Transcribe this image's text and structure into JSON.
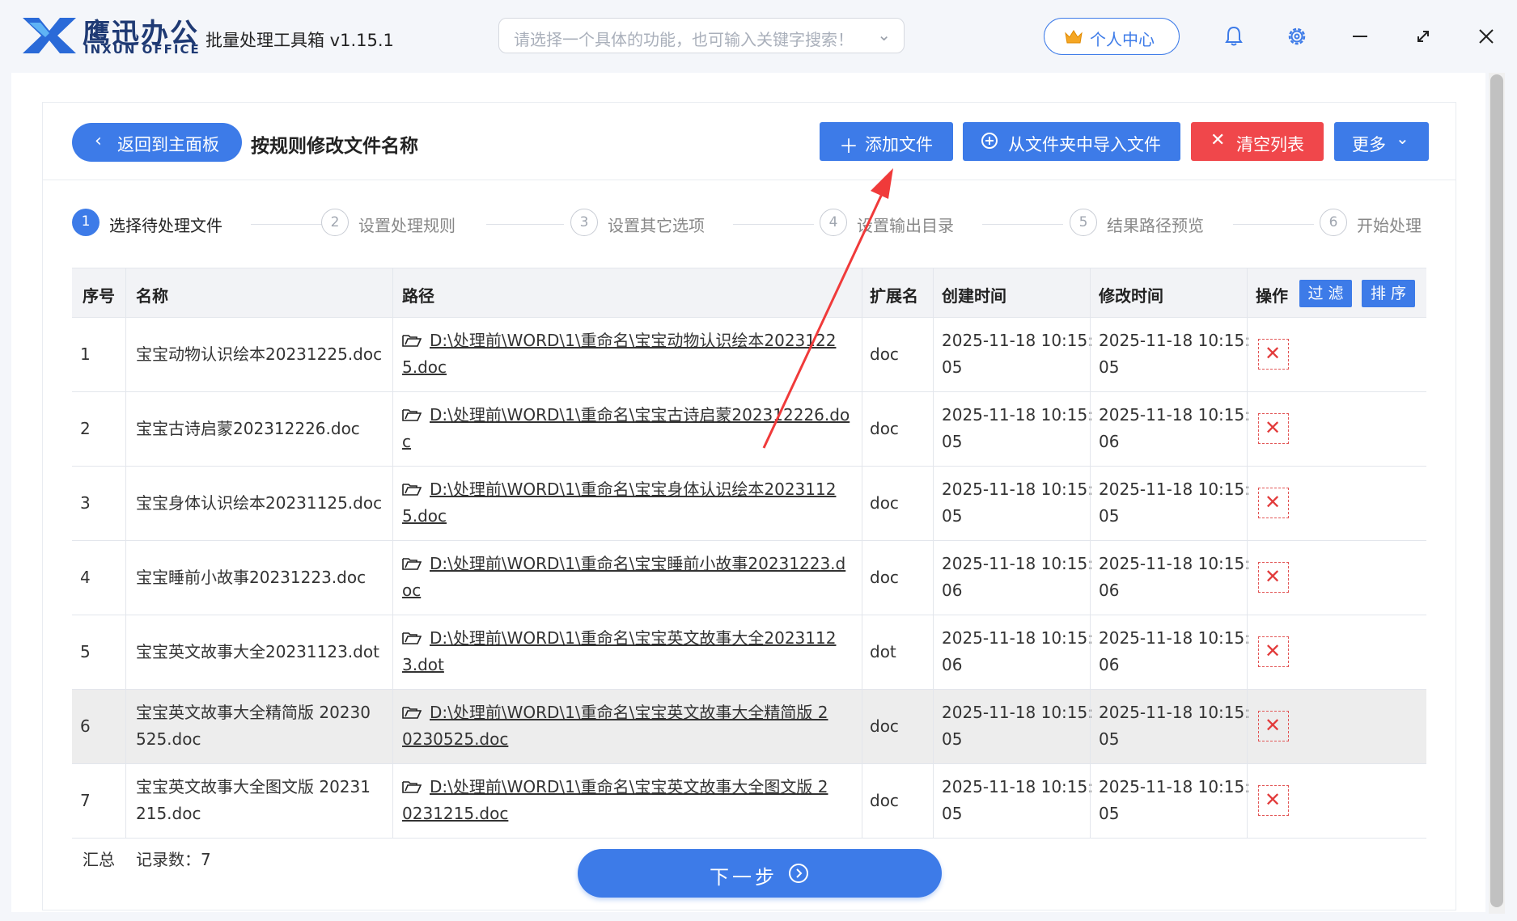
{
  "app": {
    "brand_cn": "鹰迅办公",
    "brand_en": "INXUN OFFICE",
    "title": "批量处理工具箱 v1.15.1",
    "search_placeholder": "请选择一个具体的功能，也可输入关键字搜索！",
    "user_center": "个人中心",
    "accent_color": "#3d7be8",
    "danger_color": "#f0474b"
  },
  "toolbar": {
    "back": "返回到主面板",
    "page_title": "按规则修改文件名称",
    "add_file": "添加文件",
    "import_folder": "从文件夹中导入文件",
    "clear_list": "清空列表",
    "more": "更多"
  },
  "steps": [
    {
      "num": "1",
      "label": "选择待处理文件",
      "active": true
    },
    {
      "num": "2",
      "label": "设置处理规则",
      "active": false
    },
    {
      "num": "3",
      "label": "设置其它选项",
      "active": false
    },
    {
      "num": "4",
      "label": "设置输出目录",
      "active": false
    },
    {
      "num": "5",
      "label": "结果路径预览",
      "active": false
    },
    {
      "num": "6",
      "label": "开始处理",
      "active": false
    }
  ],
  "table": {
    "headers": {
      "index": "序号",
      "name": "名称",
      "path": "路径",
      "ext": "扩展名",
      "created": "创建时间",
      "modified": "修改时间",
      "action": "操作",
      "filter": "过 滤",
      "sort": "排 序"
    },
    "rows": [
      {
        "index": "1",
        "name": [
          "宝宝动物认识绘本20231225.doc",
          ""
        ],
        "path": [
          "D:\\处理前\\WORD\\1\\重命名\\宝宝动物认识绘本2023122",
          "5.doc"
        ],
        "ext": "doc",
        "created": [
          "2025-11-18 10:15:",
          "05"
        ],
        "modified": [
          "2025-11-18 10:15:",
          "05"
        ]
      },
      {
        "index": "2",
        "name": [
          "宝宝古诗启蒙202312226.doc",
          ""
        ],
        "path": [
          "D:\\处理前\\WORD\\1\\重命名\\宝宝古诗启蒙202312226.do",
          "c"
        ],
        "ext": "doc",
        "created": [
          "2025-11-18 10:15:",
          "05"
        ],
        "modified": [
          "2025-11-18 10:15:",
          "06"
        ]
      },
      {
        "index": "3",
        "name": [
          "宝宝身体认识绘本20231125.doc",
          ""
        ],
        "path": [
          "D:\\处理前\\WORD\\1\\重命名\\宝宝身体认识绘本2023112",
          "5.doc"
        ],
        "ext": "doc",
        "created": [
          "2025-11-18 10:15:",
          "05"
        ],
        "modified": [
          "2025-11-18 10:15:",
          "05"
        ]
      },
      {
        "index": "4",
        "name": [
          "宝宝睡前小故事20231223.doc",
          ""
        ],
        "path": [
          "D:\\处理前\\WORD\\1\\重命名\\宝宝睡前小故事20231223.d",
          "oc"
        ],
        "ext": "doc",
        "created": [
          "2025-11-18 10:15:",
          "06"
        ],
        "modified": [
          "2025-11-18 10:15:",
          "06"
        ]
      },
      {
        "index": "5",
        "name": [
          "宝宝英文故事大全20231123.dot",
          ""
        ],
        "path": [
          "D:\\处理前\\WORD\\1\\重命名\\宝宝英文故事大全2023112",
          "3.dot"
        ],
        "ext": "dot",
        "created": [
          "2025-11-18 10:15:",
          "06"
        ],
        "modified": [
          "2025-11-18 10:15:",
          "06"
        ]
      },
      {
        "index": "6",
        "name": [
          "宝宝英文故事大全精简版 20230",
          "525.doc"
        ],
        "path": [
          "D:\\处理前\\WORD\\1\\重命名\\宝宝英文故事大全精简版 2",
          "0230525.doc"
        ],
        "ext": "doc",
        "created": [
          "2025-11-18 10:15:",
          "05"
        ],
        "modified": [
          "2025-11-18 10:15:",
          "05"
        ]
      },
      {
        "index": "7",
        "name": [
          "宝宝英文故事大全图文版 20231",
          "215.doc"
        ],
        "path": [
          "D:\\处理前\\WORD\\1\\重命名\\宝宝英文故事大全图文版 2",
          "0231215.doc"
        ],
        "ext": "doc",
        "created": [
          "2025-11-18 10:15:",
          "05"
        ],
        "modified": [
          "2025-11-18 10:15:",
          "05"
        ]
      }
    ],
    "summary_label": "汇总",
    "summary_count": "记录数：7"
  },
  "next_button": "下一步"
}
